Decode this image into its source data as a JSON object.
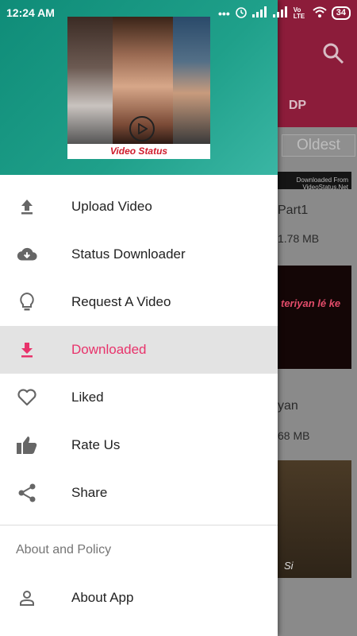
{
  "status_bar": {
    "time": "12:24 AM",
    "dots": "•••",
    "network_label": "Vo LTE",
    "battery": "34"
  },
  "header": {
    "image_caption": "Video Status"
  },
  "menu": {
    "items": [
      {
        "label": "Upload Video",
        "icon": "upload-icon"
      },
      {
        "label": "Status Downloader",
        "icon": "cloud-download-icon"
      },
      {
        "label": "Request A Video",
        "icon": "lightbulb-icon"
      },
      {
        "label": "Downloaded",
        "icon": "download-icon",
        "active": true
      },
      {
        "label": "Liked",
        "icon": "heart-icon"
      },
      {
        "label": "Rate Us",
        "icon": "thumbs-up-icon"
      },
      {
        "label": "Share",
        "icon": "share-icon"
      }
    ],
    "section_title": "About and Policy",
    "about_item": {
      "label": "About App",
      "icon": "person-icon"
    }
  },
  "background": {
    "tab_label": "DP",
    "sort_label": "Oldest",
    "cards": [
      {
        "title": "Part1",
        "size": "1.78  MB",
        "watermark": "Downloaded From VideoStatus.Net"
      },
      {
        "title": "yan",
        "size": "68  MB",
        "watermark": "teriyan  lé ke"
      },
      {
        "title": "",
        "size": "",
        "watermark": "Si"
      }
    ]
  },
  "colors": {
    "accent": "#e8336b",
    "header_teal": "#1fa08a",
    "toolbar_bg": "#8c1c3a"
  }
}
